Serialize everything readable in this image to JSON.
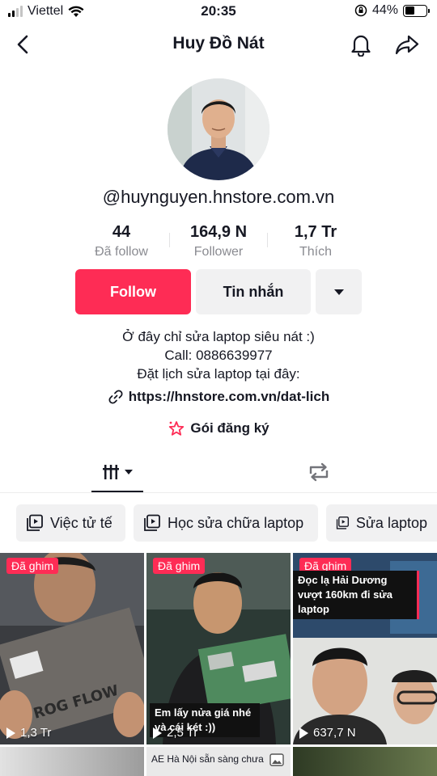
{
  "status_bar": {
    "carrier": "Viettel",
    "time": "20:35",
    "battery": "44%",
    "battery_level": 0.44
  },
  "header": {
    "title": "Huy Đồ Nát"
  },
  "profile": {
    "username": "@huynguyen.hnstore.com.vn",
    "stats": [
      {
        "value": "44",
        "label": "Đã follow"
      },
      {
        "value": "164,9 N",
        "label": "Follower"
      },
      {
        "value": "1,7 Tr",
        "label": "Thích"
      }
    ],
    "buttons": {
      "follow": "Follow",
      "message": "Tin nhắn"
    },
    "bio": [
      "Ở đây chỉ sửa laptop siêu nát :)",
      "Call: 0886639977",
      "Đặt lịch sửa laptop tại đây:"
    ],
    "link": "https://hnstore.com.vn/dat-lich",
    "subscription": "Gói đăng ký"
  },
  "playlists": [
    {
      "label": "Việc tử tế"
    },
    {
      "label": "Học sửa chữa laptop"
    },
    {
      "label": "Sửa laptop"
    }
  ],
  "videos": [
    {
      "badge": "Đã ghim",
      "views": "1,3 Tr"
    },
    {
      "badge": "Đã ghim",
      "views": "2,5 Tr",
      "caption": "Em lấy nửa giá nhé và cái két :))"
    },
    {
      "badge": "Đã ghim",
      "views": "637,7 N",
      "caption": "Đọc lạ Hải Dương vượt 160km đi sửa laptop"
    }
  ],
  "row2_caption": "AE Hà Nội sẵn sàng chưa",
  "colors": {
    "accent": "#fe2c55",
    "button_bg": "#f1f1f2",
    "text": "#161823",
    "muted": "#8a8b91"
  },
  "icons": [
    "back-icon",
    "bell-icon",
    "share-icon",
    "link-icon",
    "subscription-star-icon",
    "grid-icon",
    "repost-icon",
    "playlist-icon",
    "play-icon"
  ]
}
